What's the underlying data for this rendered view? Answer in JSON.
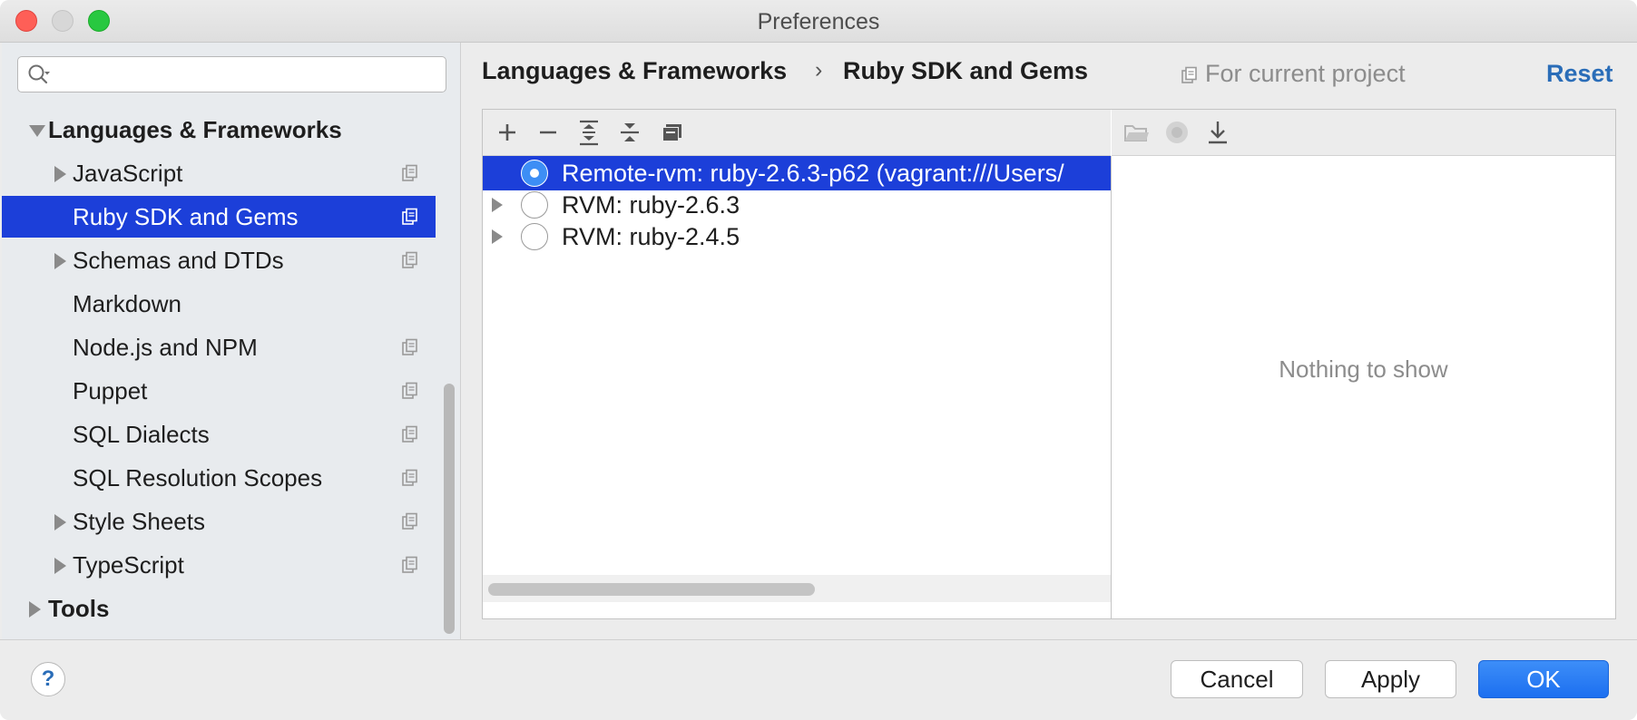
{
  "window": {
    "title": "Preferences"
  },
  "sidebar": {
    "search_placeholder": "",
    "items": [
      {
        "label": "Languages & Frameworks",
        "level": 0,
        "expander": "expanded",
        "bold": true,
        "project_icon": false,
        "selected": false
      },
      {
        "label": "JavaScript",
        "level": 1,
        "expander": "collapsed",
        "bold": false,
        "project_icon": true,
        "selected": false
      },
      {
        "label": "Ruby SDK and Gems",
        "level": 1,
        "expander": "none",
        "bold": false,
        "project_icon": true,
        "selected": true
      },
      {
        "label": "Schemas and DTDs",
        "level": 1,
        "expander": "collapsed",
        "bold": false,
        "project_icon": true,
        "selected": false
      },
      {
        "label": "Markdown",
        "level": 1,
        "expander": "none",
        "bold": false,
        "project_icon": false,
        "selected": false
      },
      {
        "label": "Node.js and NPM",
        "level": 1,
        "expander": "none",
        "bold": false,
        "project_icon": true,
        "selected": false
      },
      {
        "label": "Puppet",
        "level": 1,
        "expander": "none",
        "bold": false,
        "project_icon": true,
        "selected": false
      },
      {
        "label": "SQL Dialects",
        "level": 1,
        "expander": "none",
        "bold": false,
        "project_icon": true,
        "selected": false
      },
      {
        "label": "SQL Resolution Scopes",
        "level": 1,
        "expander": "none",
        "bold": false,
        "project_icon": true,
        "selected": false
      },
      {
        "label": "Style Sheets",
        "level": 1,
        "expander": "collapsed",
        "bold": false,
        "project_icon": true,
        "selected": false
      },
      {
        "label": "TypeScript",
        "level": 1,
        "expander": "collapsed",
        "bold": false,
        "project_icon": true,
        "selected": false
      },
      {
        "label": "Tools",
        "level": 0,
        "expander": "collapsed",
        "bold": true,
        "project_icon": false,
        "selected": false
      }
    ]
  },
  "header": {
    "breadcrumb_parent": "Languages & Frameworks",
    "breadcrumb_separator": "›",
    "breadcrumb_current": "Ruby SDK and Gems",
    "scope_label": "For current project",
    "reset_label": "Reset"
  },
  "sdk_toolbar": {
    "buttons": [
      "add-icon",
      "remove-icon",
      "expand-all-icon",
      "collapse-all-icon",
      "copy-icon"
    ]
  },
  "sdk_list": [
    {
      "label": "Remote-rvm: ruby-2.6.3-p62 (vagrant:///Users/",
      "selected": true,
      "expandable": false
    },
    {
      "label": "RVM: ruby-2.6.3",
      "selected": false,
      "expandable": true
    },
    {
      "label": "RVM: ruby-2.4.5",
      "selected": false,
      "expandable": true
    }
  ],
  "gem_toolbar": {
    "buttons": [
      "open-folder-icon",
      "circle-icon",
      "download-icon"
    ]
  },
  "gem_panel": {
    "empty_text": "Nothing to show"
  },
  "footer": {
    "help_label": "?",
    "cancel_label": "Cancel",
    "apply_label": "Apply",
    "ok_label": "OK"
  },
  "colors": {
    "selection": "#1c3fd9",
    "primary_button": "#1c6ff0",
    "link": "#2a6db8"
  }
}
